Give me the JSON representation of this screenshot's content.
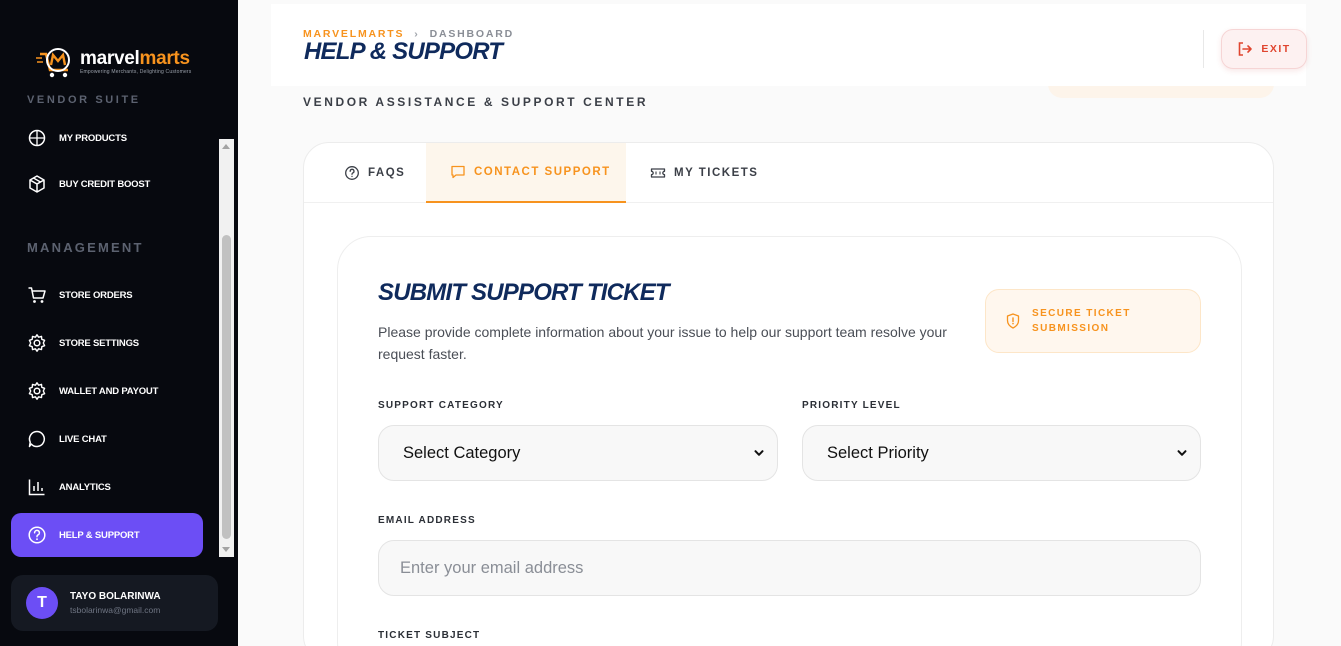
{
  "brand": {
    "name_part1": "marvel",
    "name_part2": "marts",
    "tagline": "Empowering Merchants, Delighting Customers",
    "suite_label": "VENDOR SUITE"
  },
  "sidebar": {
    "partial_item": "MY PRODUCTS",
    "items_top": [
      {
        "label": "BUY CREDIT BOOST",
        "icon": "box-icon"
      }
    ],
    "management_label": "MANAGEMENT",
    "items": [
      {
        "label": "STORE ORDERS",
        "icon": "cart-icon"
      },
      {
        "label": "STORE SETTINGS",
        "icon": "gear-icon"
      },
      {
        "label": "WALLET AND PAYOUT",
        "icon": "gear-icon"
      },
      {
        "label": "LIVE CHAT",
        "icon": "chat-icon"
      },
      {
        "label": "ANALYTICS",
        "icon": "bar-chart-icon"
      },
      {
        "label": "HELP & SUPPORT",
        "icon": "help-circle-icon",
        "active": true
      }
    ]
  },
  "user": {
    "initial": "T",
    "name": "TAYO BOLARINWA",
    "email": "tsbolarinwa@gmail.com"
  },
  "header": {
    "breadcrumb_brand": "MARVELMARTS",
    "breadcrumb_sep": "›",
    "breadcrumb_current": "DASHBOARD",
    "title": "HELP & SUPPORT",
    "subtitle": "VENDOR ASSISTANCE & SUPPORT CENTER",
    "exit_label": "EXIT"
  },
  "tabs": [
    {
      "label": "FAQS",
      "icon": "help-circle-icon"
    },
    {
      "label": "CONTACT SUPPORT",
      "icon": "message-icon",
      "active": true
    },
    {
      "label": "MY TICKETS",
      "icon": "ticket-icon"
    }
  ],
  "form": {
    "title": "SUBMIT SUPPORT TICKET",
    "description": "Please provide complete information about your issue to help our support team resolve your request faster.",
    "secure_badge": "SECURE TICKET SUBMISSION",
    "category_label": "SUPPORT CATEGORY",
    "category_value": "Select Category",
    "priority_label": "PRIORITY LEVEL",
    "priority_value": "Select Priority",
    "email_label": "EMAIL ADDRESS",
    "email_placeholder": "Enter your email address",
    "subject_label": "TICKET SUBJECT"
  },
  "colors": {
    "accent_orange": "#f7931e",
    "active_purple": "#6c4ef5",
    "title_navy": "#0f2a5c",
    "exit_red": "#e0452f"
  }
}
